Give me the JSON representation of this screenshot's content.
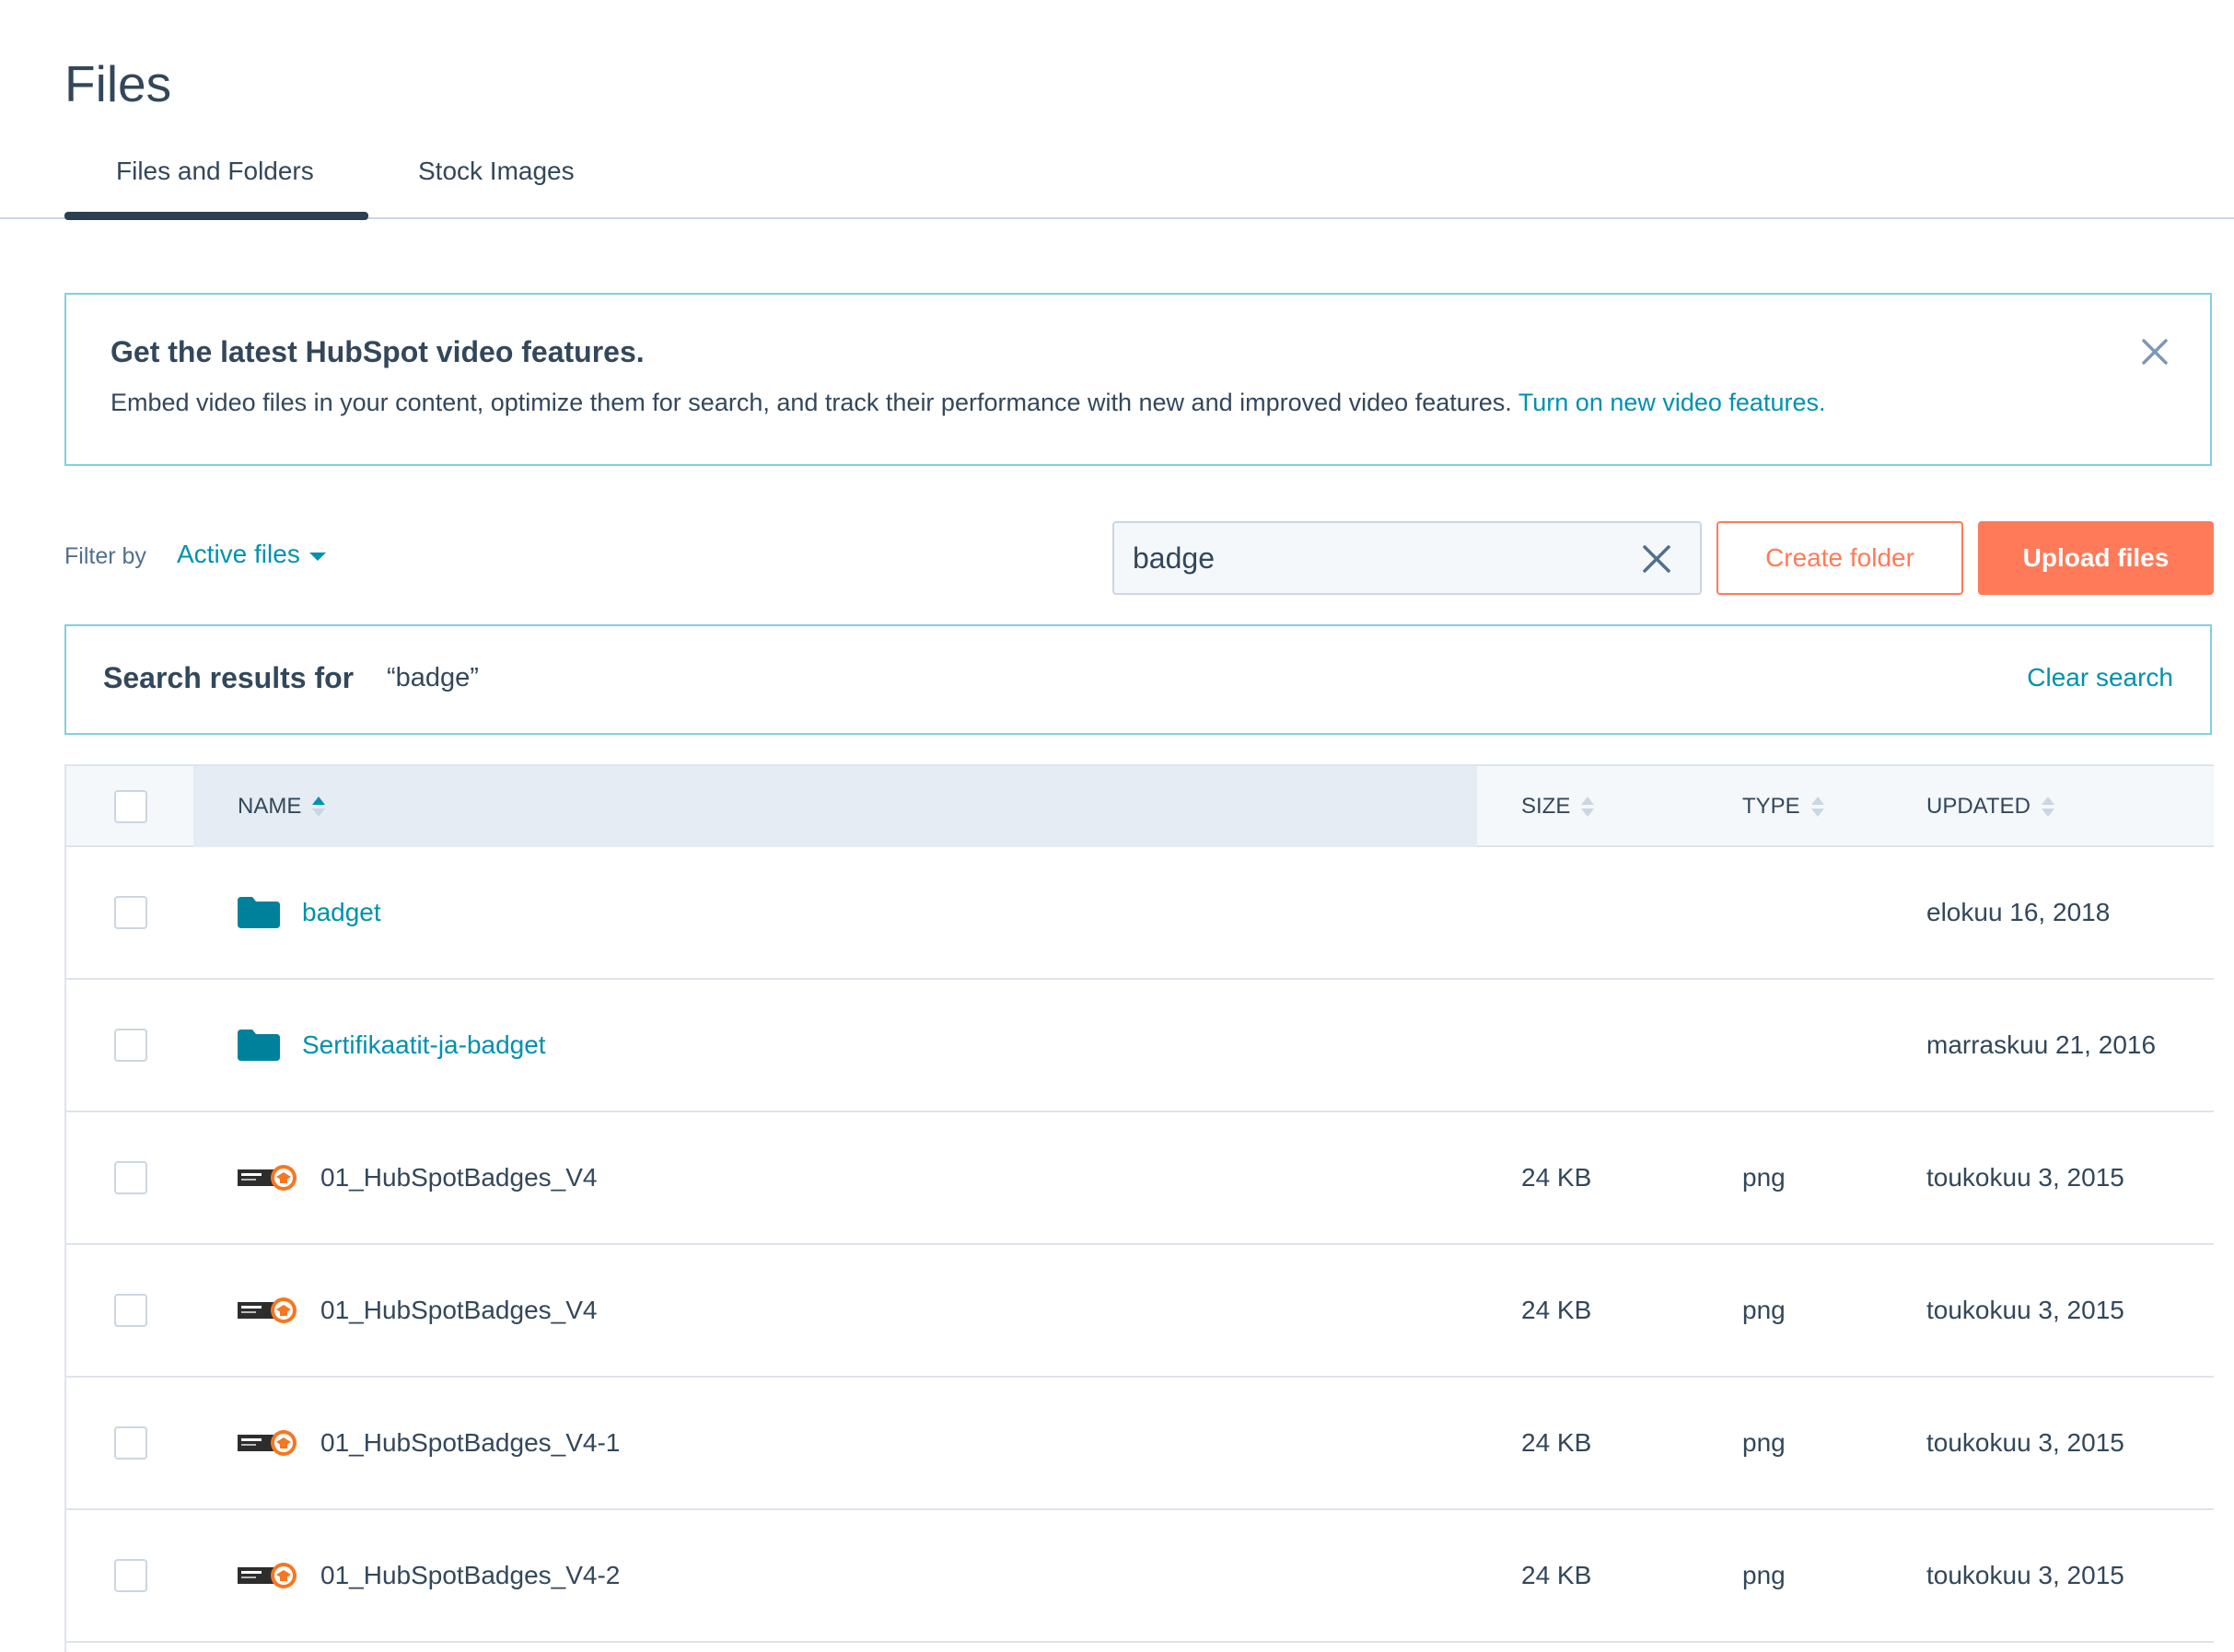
{
  "page": {
    "title": "Files"
  },
  "tabs": [
    {
      "label": "Files and Folders",
      "active": true
    },
    {
      "label": "Stock Images",
      "active": false
    }
  ],
  "banner": {
    "title": "Get the latest HubSpot video features.",
    "body": "Embed video files in your content, optimize them for search, and track their performance with new and improved video features.",
    "link": "Turn on new video features.",
    "close_icon": "close-icon"
  },
  "toolbar": {
    "filter_label": "Filter by",
    "filter_value": "Active files",
    "search_value": "badge",
    "create_folder": "Create folder",
    "upload_files": "Upload files"
  },
  "results": {
    "label": "Search results for",
    "query": "“badge”",
    "clear": "Clear search"
  },
  "table": {
    "columns": {
      "name": "NAME",
      "size": "SIZE",
      "type": "TYPE",
      "updated": "UPDATED"
    },
    "rows": [
      {
        "kind": "folder",
        "name": "badget",
        "size": "",
        "type": "",
        "updated": "elokuu 16, 2018"
      },
      {
        "kind": "folder",
        "name": "Sertifikaatit-ja-badget",
        "size": "",
        "type": "",
        "updated": "marraskuu 21, 2016"
      },
      {
        "kind": "file",
        "name": "01_HubSpotBadges_V4",
        "size": "24 KB",
        "type": "png",
        "updated": "toukokuu 3, 2015"
      },
      {
        "kind": "file",
        "name": "01_HubSpotBadges_V4",
        "size": "24 KB",
        "type": "png",
        "updated": "toukokuu 3, 2015"
      },
      {
        "kind": "file",
        "name": "01_HubSpotBadges_V4-1",
        "size": "24 KB",
        "type": "png",
        "updated": "toukokuu 3, 2015"
      },
      {
        "kind": "file",
        "name": "01_HubSpotBadges_V4-2",
        "size": "24 KB",
        "type": "png",
        "updated": "toukokuu 3, 2015"
      }
    ]
  },
  "colors": {
    "accent": "#0091ae",
    "primary_button": "#ff7a59",
    "text": "#33475b",
    "border_highlight": "#7fd1de"
  }
}
